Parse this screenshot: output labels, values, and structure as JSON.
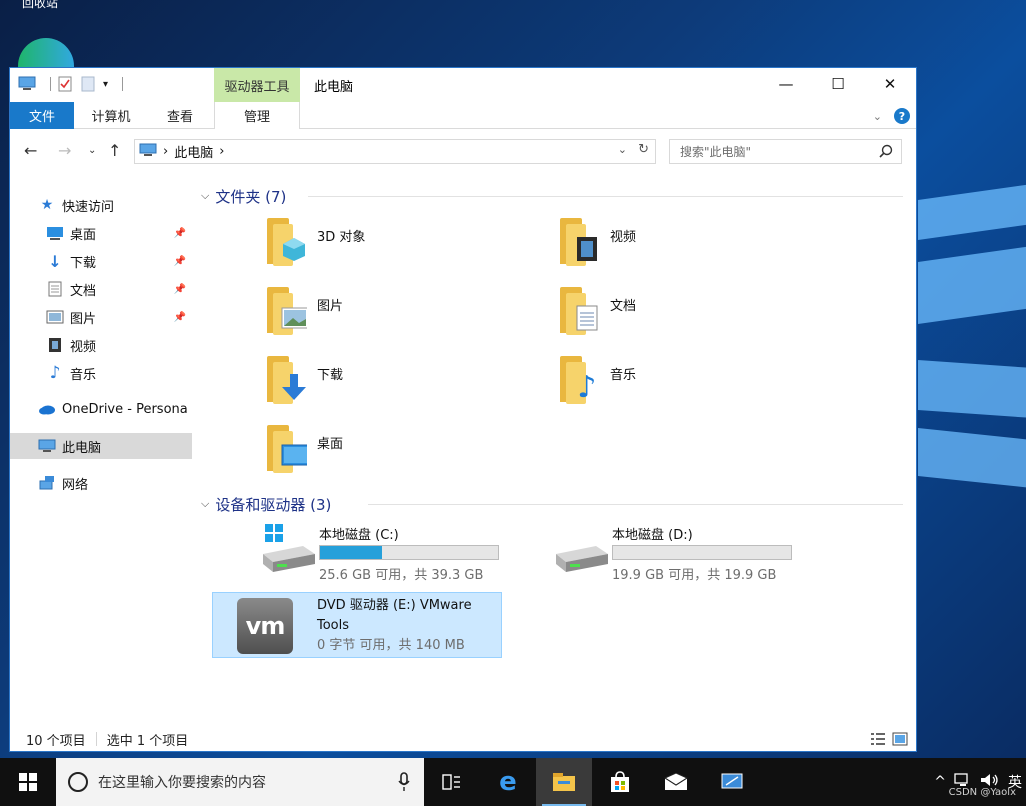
{
  "desktop": {
    "top_label": "回收站"
  },
  "window": {
    "title": "此电脑",
    "context_tab_header": "驱动器工具",
    "ribbon_tabs": [
      "文件",
      "计算机",
      "查看",
      "管理"
    ],
    "controls": {
      "minimize": "—",
      "maximize": "☐",
      "close": "✕"
    }
  },
  "address": {
    "crumbs": [
      "此电脑"
    ],
    "search_placeholder": "搜索\"此电脑\""
  },
  "nav": {
    "quick_access": "快速访问",
    "quick_items": [
      "桌面",
      "下载",
      "文档",
      "图片",
      "视频",
      "音乐"
    ],
    "onedrive": "OneDrive - Persona",
    "this_pc": "此电脑",
    "network": "网络"
  },
  "folders": {
    "header": "文件夹 (7)",
    "items": [
      "3D 对象",
      "视频",
      "图片",
      "文档",
      "下载",
      "音乐",
      "桌面"
    ]
  },
  "drives": {
    "header": "设备和驱动器 (3)",
    "items": [
      {
        "name": "本地磁盘 (C:)",
        "free": "25.6 GB 可用，共 39.3 GB",
        "used_fraction": 0.35
      },
      {
        "name": "本地磁盘 (D:)",
        "free": "19.9 GB 可用，共 19.9 GB",
        "used_fraction": 0.0
      },
      {
        "name_line1": "DVD 驱动器 (E:) VMware",
        "name_line2": "Tools",
        "free": "0 字节 可用，共 140 MB",
        "logo": "vm"
      }
    ]
  },
  "status": {
    "count": "10 个项目",
    "selected": "选中 1 个项目"
  },
  "taskbar": {
    "search_placeholder": "在这里输入你要搜索的内容",
    "tray_text": "^",
    "lang": "英",
    "watermark": "CSDN @Yaolx"
  },
  "colors": {
    "accent": "#1979ca",
    "context_tab": "#c9e8a8",
    "drive_fill": "#26a0da",
    "selection": "#cce8ff",
    "group_header": "#1e3287"
  }
}
